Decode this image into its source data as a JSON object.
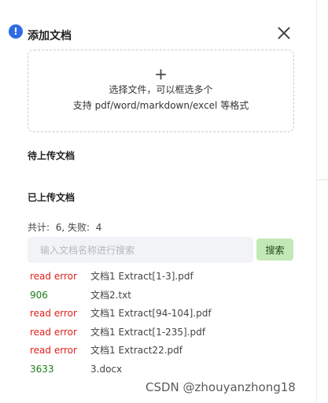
{
  "dialog": {
    "title": "添加文档",
    "dropzone": {
      "plus": "+",
      "line1": "选择文件，可以框选多个",
      "line2": "支持 pdf/word/markdown/excel 等格式"
    },
    "pending_title": "待上传文档",
    "uploaded_title": "已上传文档",
    "counts": {
      "total_label": "共计:",
      "total": "6",
      "fail_label": "失败:",
      "fail": "4"
    },
    "search": {
      "placeholder": "输入文档名称进行搜索",
      "value": "",
      "button_label": "搜索"
    },
    "files": [
      {
        "status": "read error",
        "status_type": "error",
        "name": "文档1 Extract[1-3].pdf"
      },
      {
        "status": "906",
        "status_type": "ok",
        "name": "文档2.txt"
      },
      {
        "status": "read error",
        "status_type": "error",
        "name": "文档1 Extract[94-104].pdf"
      },
      {
        "status": "read error",
        "status_type": "error",
        "name": "文档1 Extract[1-235].pdf"
      },
      {
        "status": "read error",
        "status_type": "error",
        "name": "文档1 Extract22.pdf"
      },
      {
        "status": "3633",
        "status_type": "ok",
        "name": "3.docx"
      }
    ]
  },
  "watermark": "CSDN @zhouyanzhong18",
  "colors": {
    "error": "#e0201b",
    "ok": "#1d7a16",
    "search_button": "#c3e8b7",
    "alert_icon": "#2e6be6"
  }
}
